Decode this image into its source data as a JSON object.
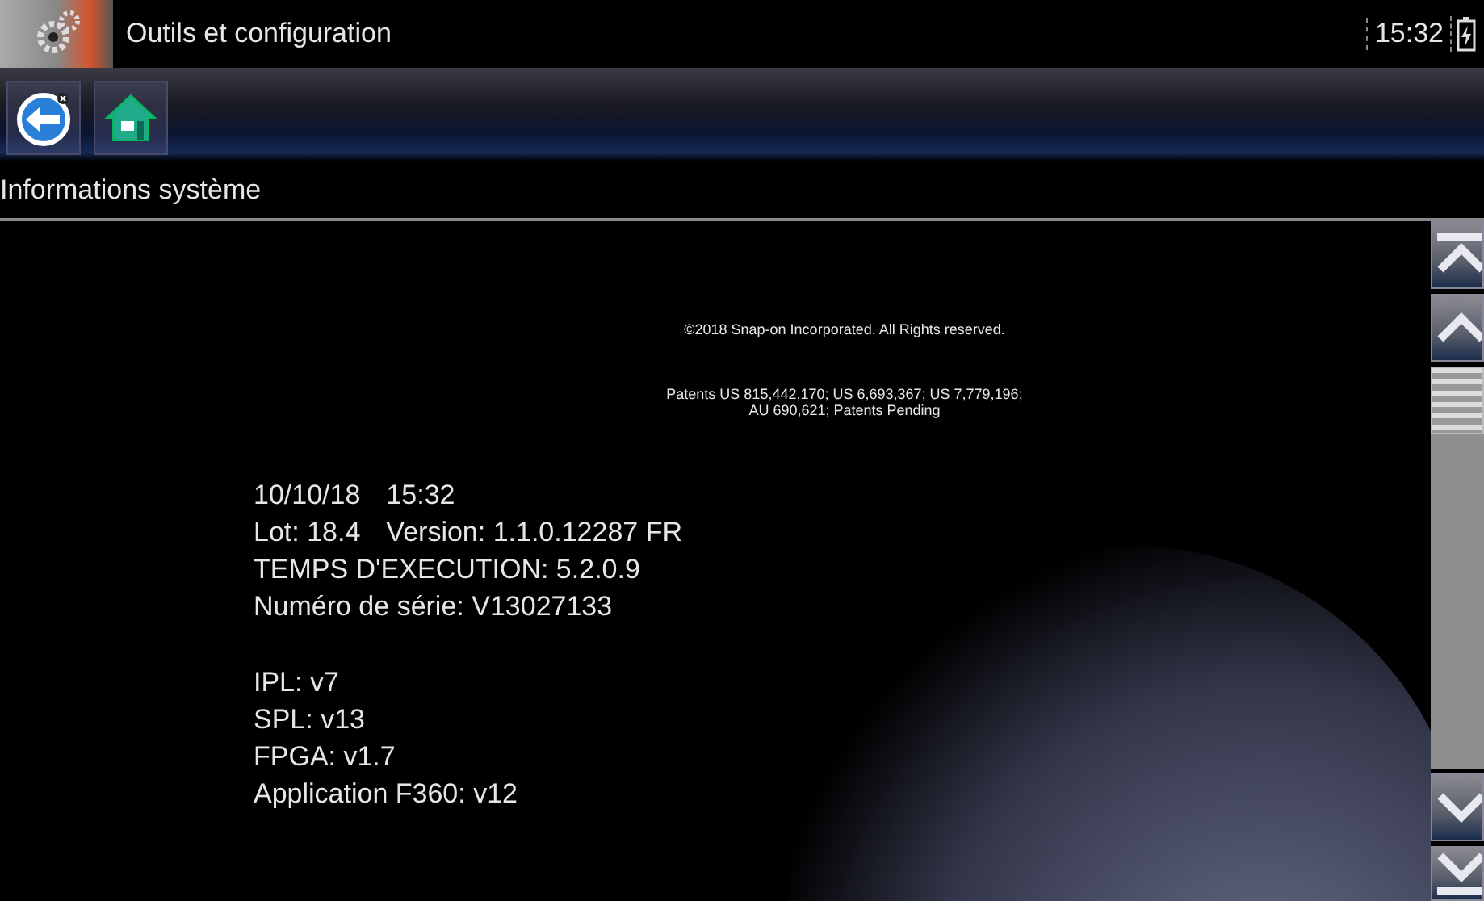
{
  "title_bar": {
    "title": "Outils et configuration",
    "time": "15:32"
  },
  "toolbar": {
    "buttons": [
      {
        "kind": "back"
      },
      {
        "kind": "home"
      }
    ]
  },
  "section_header": "Informations système",
  "copyright": "©2018 Snap-on Incorporated. All Rights reserved.",
  "patents": [
    "Patents US 815,442,170; US 6,693,367; US 7,779,196;",
    "AU 690,621; Patents Pending"
  ],
  "info_groups": [
    [
      [
        "10/10/18",
        "15:32"
      ],
      [
        "Lot: 18.4",
        "Version: 1.1.0.12287  FR"
      ],
      [
        "TEMPS D'EXECUTION: 5.2.0.9"
      ],
      [
        "Numéro de série: V13027133"
      ]
    ],
    [
      [
        "IPL: v7"
      ],
      [
        "SPL: v13"
      ],
      [
        "FPGA: v1.7"
      ],
      [
        "Application F360: v12"
      ]
    ]
  ]
}
